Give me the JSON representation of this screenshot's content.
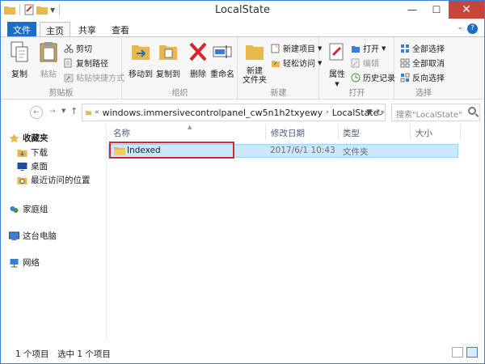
{
  "window": {
    "title": "LocalState",
    "minimize": "—",
    "maximize": "☐",
    "close": "✕"
  },
  "tabs": {
    "file": "文件",
    "home": "主页",
    "share": "共享",
    "view": "查看",
    "help": "?"
  },
  "ribbon": {
    "clipboard": {
      "label": "剪贴板",
      "copy": "复制",
      "paste": "粘贴",
      "cut": "剪切",
      "copy_path": "复制路径",
      "paste_shortcut": "粘贴快捷方式"
    },
    "organize": {
      "label": "组织",
      "move_to": "移动到",
      "copy_to": "复制到",
      "delete": "删除",
      "rename": "重命名"
    },
    "new": {
      "label": "新建",
      "new_folder": "新建\n文件夹",
      "new_item": "新建项目",
      "easy_access": "轻松访问"
    },
    "open": {
      "label": "打开",
      "properties": "属性",
      "open": "打开",
      "edit": "编辑",
      "history": "历史记录"
    },
    "select": {
      "label": "选择",
      "select_all": "全部选择",
      "select_none": "全部取消",
      "invert": "反向选择"
    }
  },
  "address": {
    "prefix": "«",
    "segment1": "windows.immersivecontrolpanel_cw5n1h2txyewy",
    "segment2": "LocalState",
    "search_placeholder": "搜索\"LocalState\""
  },
  "nav": {
    "favorites": "收藏夹",
    "downloads": "下载",
    "desktop": "桌面",
    "recent": "最近访问的位置",
    "homegroup": "家庭组",
    "this_pc": "这台电脑",
    "network": "网络"
  },
  "columns": {
    "name": "名称",
    "date": "修改日期",
    "type": "类型",
    "size": "大小"
  },
  "files": [
    {
      "name": "Indexed",
      "date": "2017/6/1 10:43",
      "type": "文件夹",
      "size": ""
    }
  ],
  "status": {
    "count": "1 个项目",
    "selected": "选中 1 个项目"
  },
  "colors": {
    "accent": "#1e6cc9",
    "selection": "#cce8ff",
    "highlight_box": "#d8262e",
    "folder": "#e8b84a"
  }
}
